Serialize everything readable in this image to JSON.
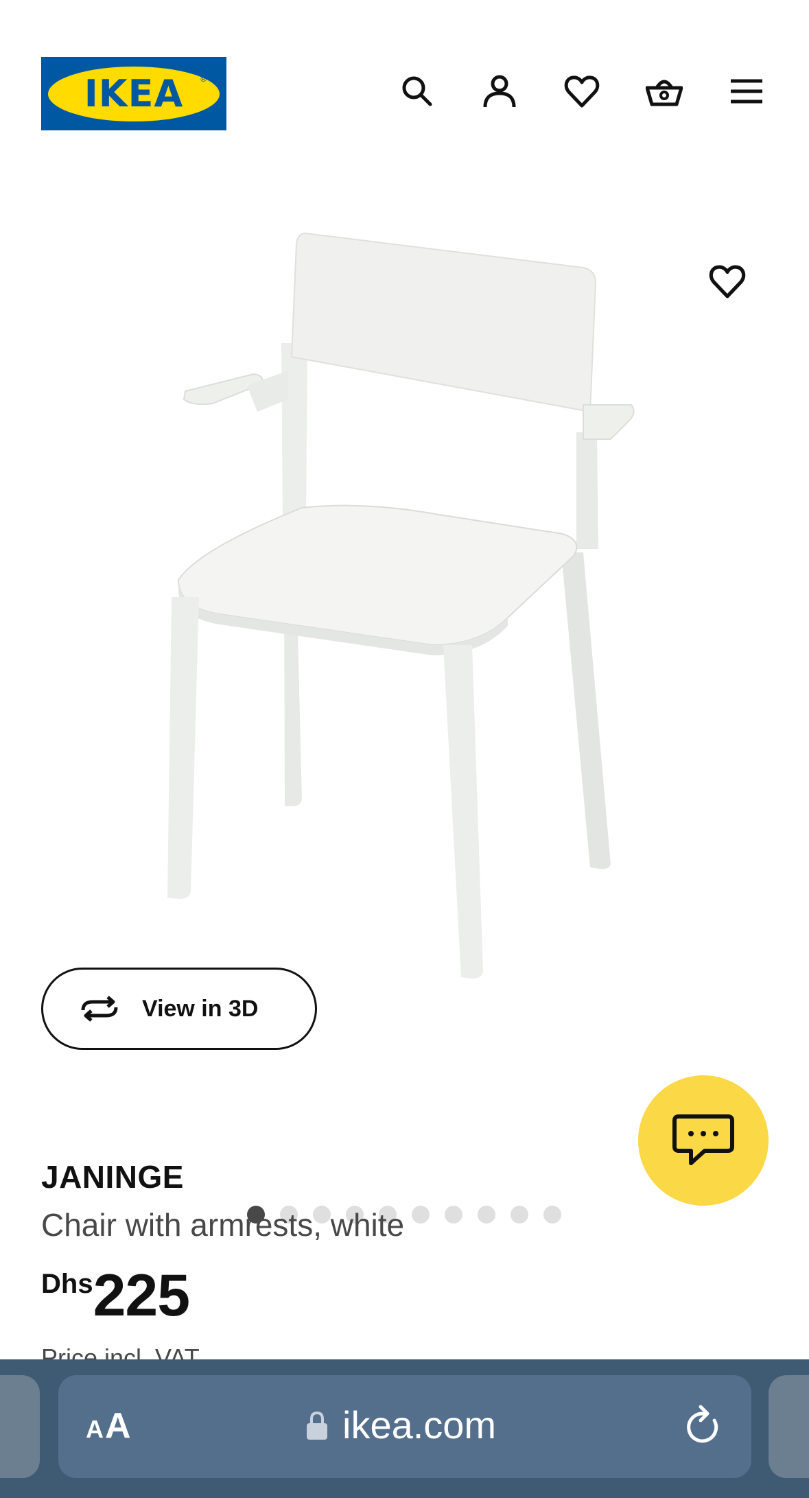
{
  "header": {
    "logo_text": "IKEA",
    "logo_registered": "®",
    "icons": [
      "search-icon",
      "account-icon",
      "heart-icon",
      "basket-icon",
      "menu-icon"
    ]
  },
  "gallery": {
    "view_3d_label": "View in 3D",
    "dot_count": 10,
    "active_dot": 1
  },
  "product": {
    "name": "JANINGE",
    "description": "Chair with armrests, white",
    "currency": "Dhs",
    "price": "225",
    "vat_note": "Price incl. VAT"
  },
  "browser": {
    "text_size_small": "A",
    "text_size_large": "A",
    "url": "ikea.com"
  },
  "colors": {
    "ikea_blue": "#0058a3",
    "ikea_yellow": "#ffdb00",
    "chat_yellow": "#fbd846",
    "browser_bar": "#3f5a73"
  }
}
